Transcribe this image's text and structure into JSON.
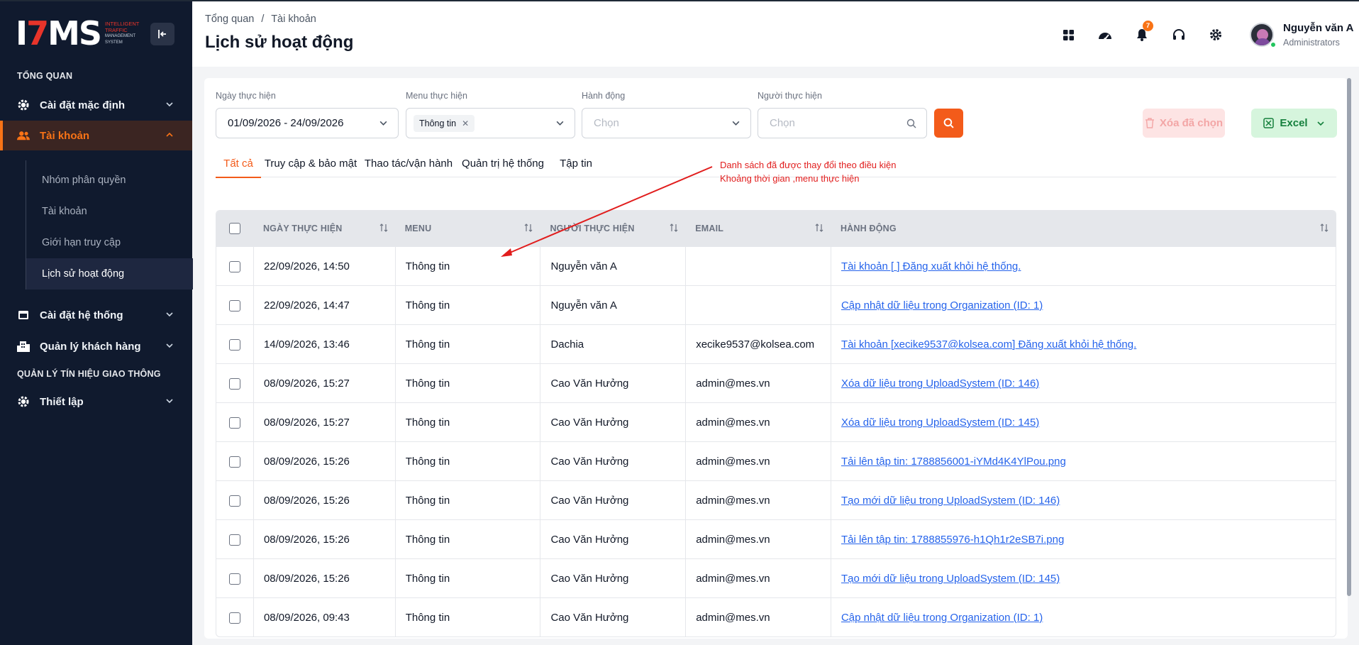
{
  "logo": {
    "mark_a": "I",
    "mark_b": "7",
    "mark_c": "MS",
    "line1": "INTELLIGENT",
    "line2": "TRAFFIC",
    "line3": "MANAGEMENT",
    "line4": "SYSTEM"
  },
  "sidebar": {
    "section1": "TỔNG QUAN",
    "section2": "QUẢN LÝ TÍN HIỆU GIAO THÔNG",
    "items": [
      {
        "label": "Cài đặt mặc định",
        "icon": "gear-icon"
      },
      {
        "label": "Tài khoản",
        "icon": "users-icon"
      },
      {
        "label": "Cài đặt hệ thống",
        "icon": "window-icon"
      },
      {
        "label": "Quản lý khách hàng",
        "icon": "building-icon"
      },
      {
        "label": "Thiết lập",
        "icon": "gear-icon"
      }
    ],
    "sub_items": [
      "Nhóm phân quyền",
      "Tài khoản",
      "Giới hạn truy cập",
      "Lịch sử hoạt động"
    ]
  },
  "header": {
    "breadcrumb_1": "Tổng quan",
    "breadcrumb_sep": "/",
    "breadcrumb_2": "Tài khoản",
    "title": "Lịch sử hoạt động",
    "notification_count": "7",
    "user_name": "Nguyễn văn A",
    "user_role": "Administrators"
  },
  "filters": {
    "date_label": "Ngày thực hiện",
    "date_value": "01/09/2026 - 24/09/2026",
    "menu_label": "Menu thực hiện",
    "menu_chip": "Thông tin",
    "action_label": "Hành động",
    "action_placeholder": "Chọn",
    "user_label": "Người thực hiện",
    "user_placeholder": "Chọn",
    "delete_label": "Xóa đã chọn",
    "excel_label": "Excel"
  },
  "tabs": [
    "Tất cả",
    "Truy cập & bảo mật",
    "Thao tác/vận hành",
    "Quản trị hệ thống",
    "Tập tin"
  ],
  "annotation": {
    "line1": "Danh sách đã được thay đổi theo điều kiện",
    "line2": "Khoảng thời gian ,menu thực hiện",
    "color": "#e11d1d"
  },
  "table": {
    "headers": [
      "NGÀY THỰC HIỆN",
      "MENU",
      "NGƯỜI THỰC HIỆN",
      "EMAIL",
      "HÀNH ĐỘNG"
    ],
    "rows": [
      {
        "date": "22/09/2026, 14:50",
        "menu": "Thông tin",
        "user": "Nguyễn văn A",
        "email": "",
        "action": "Tài khoản [ ] Đăng xuất khỏi hệ thống."
      },
      {
        "date": "22/09/2026, 14:47",
        "menu": "Thông tin",
        "user": "Nguyễn văn A",
        "email": "",
        "action": "Cập nhật dữ liệu trong Organization (ID: 1)"
      },
      {
        "date": "14/09/2026, 13:46",
        "menu": "Thông tin",
        "user": "Dachia",
        "email": "xecike9537@kolsea.com",
        "action": "Tài khoản [xecike9537@kolsea.com] Đăng xuất khỏi hệ thống."
      },
      {
        "date": "08/09/2026, 15:27",
        "menu": "Thông tin",
        "user": "Cao Văn Hưởng",
        "email": "admin@mes.vn",
        "action": "Xóa dữ liệu trong UploadSystem (ID: 146)"
      },
      {
        "date": "08/09/2026, 15:27",
        "menu": "Thông tin",
        "user": "Cao Văn Hưởng",
        "email": "admin@mes.vn",
        "action": "Xóa dữ liệu trong UploadSystem (ID: 145)"
      },
      {
        "date": "08/09/2026, 15:26",
        "menu": "Thông tin",
        "user": "Cao Văn Hưởng",
        "email": "admin@mes.vn",
        "action": "Tải lên tập tin: 1788856001-iYMd4K4YlPou.png"
      },
      {
        "date": "08/09/2026, 15:26",
        "menu": "Thông tin",
        "user": "Cao Văn Hưởng",
        "email": "admin@mes.vn",
        "action": "Tạo mới dữ liệu trong UploadSystem (ID: 146)"
      },
      {
        "date": "08/09/2026, 15:26",
        "menu": "Thông tin",
        "user": "Cao Văn Hưởng",
        "email": "admin@mes.vn",
        "action": "Tải lên tập tin: 1788855976-h1Qh1r2eSB7i.png"
      },
      {
        "date": "08/09/2026, 15:26",
        "menu": "Thông tin",
        "user": "Cao Văn Hưởng",
        "email": "admin@mes.vn",
        "action": "Tạo mới dữ liệu trong UploadSystem (ID: 145)"
      },
      {
        "date": "08/09/2026, 09:43",
        "menu": "Thông tin",
        "user": "Cao Văn Hưởng",
        "email": "admin@mes.vn",
        "action": "Cập nhật dữ liệu trong Organization (ID: 1)"
      }
    ]
  },
  "colors": {
    "accent": "#f35b1a",
    "sidebar_bg": "#101a2e",
    "link": "#2563eb",
    "excel_green": "#15803d"
  }
}
